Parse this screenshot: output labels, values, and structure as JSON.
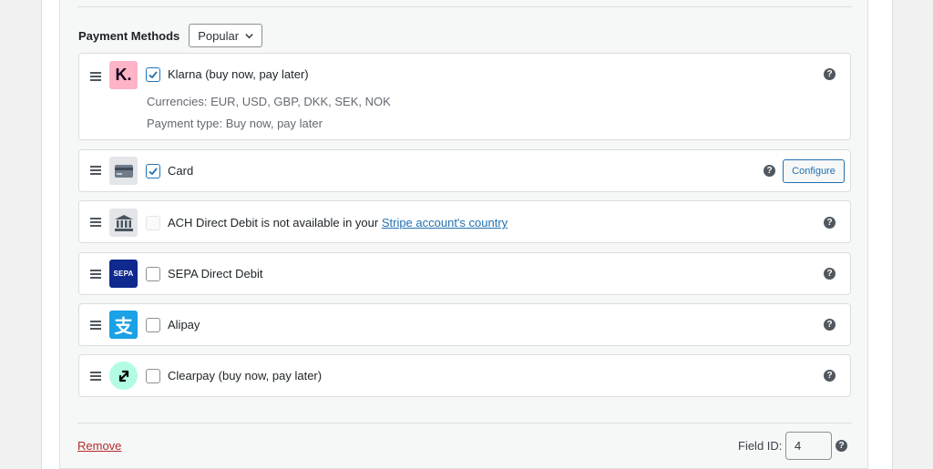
{
  "payment_methods": {
    "label": "Payment Methods",
    "filter": {
      "selected": "Popular",
      "icon": "chevron-down-icon"
    }
  },
  "methods": [
    {
      "label": "Klarna (buy now, pay later)",
      "logo_text": "K.",
      "checked": true,
      "details": [
        "Currencies: EUR, USD, GBP, DKK, SEK, NOK",
        "Payment type: Buy now, pay later"
      ],
      "help": "?"
    },
    {
      "label": "Card",
      "checked": true,
      "configure_label": "Configure",
      "help": "?"
    },
    {
      "label_prefix": "ACH Direct Debit is not available in your ",
      "link_text": "Stripe account's country",
      "checked": false,
      "disabled": true,
      "help": "?"
    },
    {
      "label": "SEPA Direct Debit",
      "logo_text": "SEPA",
      "checked": false,
      "help": "?"
    },
    {
      "label": "Alipay",
      "logo_text": "支",
      "checked": false,
      "help": "?"
    },
    {
      "label": "Clearpay (buy now, pay later)",
      "checked": false,
      "help": "?"
    }
  ],
  "footer": {
    "remove_label": "Remove",
    "field_id_label": "Field ID:",
    "field_id_value": "4",
    "help": "?"
  },
  "colors": {
    "accent": "#2271b1",
    "klarna_pink": "#ffb3c7",
    "sepa_blue": "#10298e",
    "alipay_blue": "#1aa1e6",
    "clearpay_mint": "#b2fce4",
    "remove_red": "#b32d2e"
  }
}
